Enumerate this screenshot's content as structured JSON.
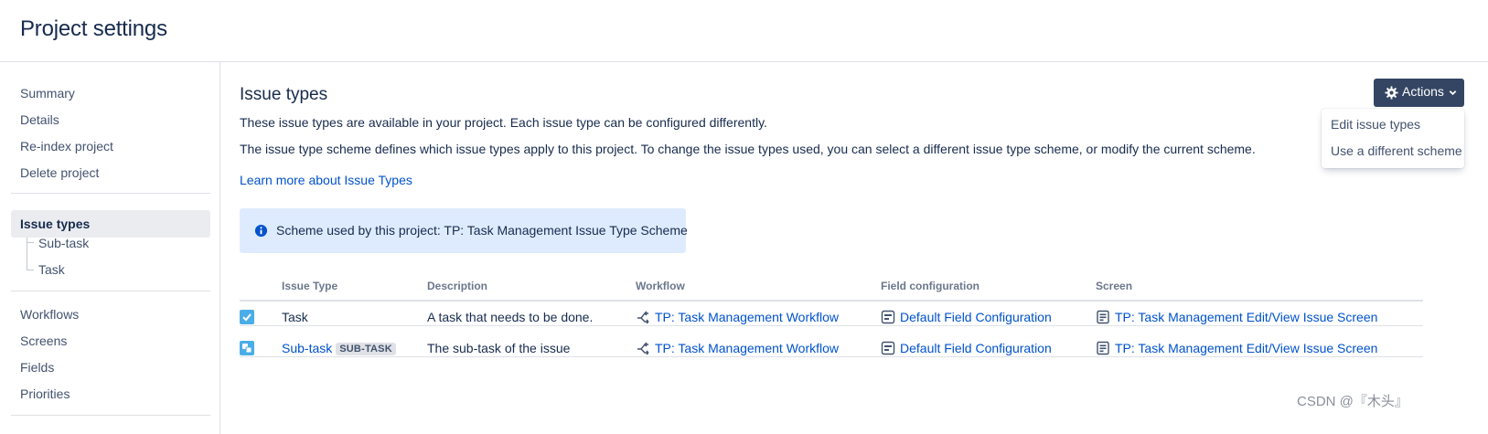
{
  "page": {
    "title": "Project settings"
  },
  "sidebar": {
    "items": [
      {
        "label": "Summary"
      },
      {
        "label": "Details"
      },
      {
        "label": "Re-index project"
      },
      {
        "label": "Delete project"
      },
      {
        "label": "Issue types"
      },
      {
        "label": "Sub-task"
      },
      {
        "label": "Task"
      },
      {
        "label": "Workflows"
      },
      {
        "label": "Screens"
      },
      {
        "label": "Fields"
      },
      {
        "label": "Priorities"
      }
    ]
  },
  "main": {
    "title": "Issue types",
    "desc1": "These issue types are available in your project. Each issue type can be configured differently.",
    "desc2": "The issue type scheme defines which issue types apply to this project. To change the issue types used, you can select a different issue type scheme, or modify the current scheme.",
    "learn_more": "Learn more about Issue Types",
    "scheme_info": "Scheme used by this project: TP: Task Management Issue Type Scheme"
  },
  "actions": {
    "label": "Actions",
    "menu": [
      {
        "label": "Edit issue types"
      },
      {
        "label": "Use a different scheme"
      }
    ]
  },
  "table": {
    "headers": [
      "Issue Type",
      "Description",
      "Workflow",
      "Field configuration",
      "Screen"
    ],
    "rows": [
      {
        "issue_type": "Task",
        "badge": "",
        "description": "A task that needs to be done.",
        "workflow": "TP: Task Management Workflow",
        "field_config": "Default Field Configuration",
        "screen": "TP: Task Management Edit/View Issue Screen"
      },
      {
        "issue_type": "Sub-task",
        "badge": "SUB-TASK",
        "description": "The sub-task of the issue",
        "workflow": "TP: Task Management Workflow",
        "field_config": "Default Field Configuration",
        "screen": "TP: Task Management Edit/View Issue Screen"
      }
    ]
  },
  "icons": {
    "task": "checkbox-task-icon",
    "subtask": "subtask-icon",
    "workflow": "workflow-icon",
    "field_config": "field-config-icon",
    "screen": "screen-icon",
    "info": "info-icon",
    "gear": "gear-icon",
    "chevron": "chevron-down-icon"
  },
  "colors": {
    "link": "#0052cc",
    "button": "#344563",
    "info_bg": "#deebff",
    "task_icon": "#4bade8",
    "active_nav": "#ebecf0"
  },
  "watermark": "CSDN @『木头』"
}
